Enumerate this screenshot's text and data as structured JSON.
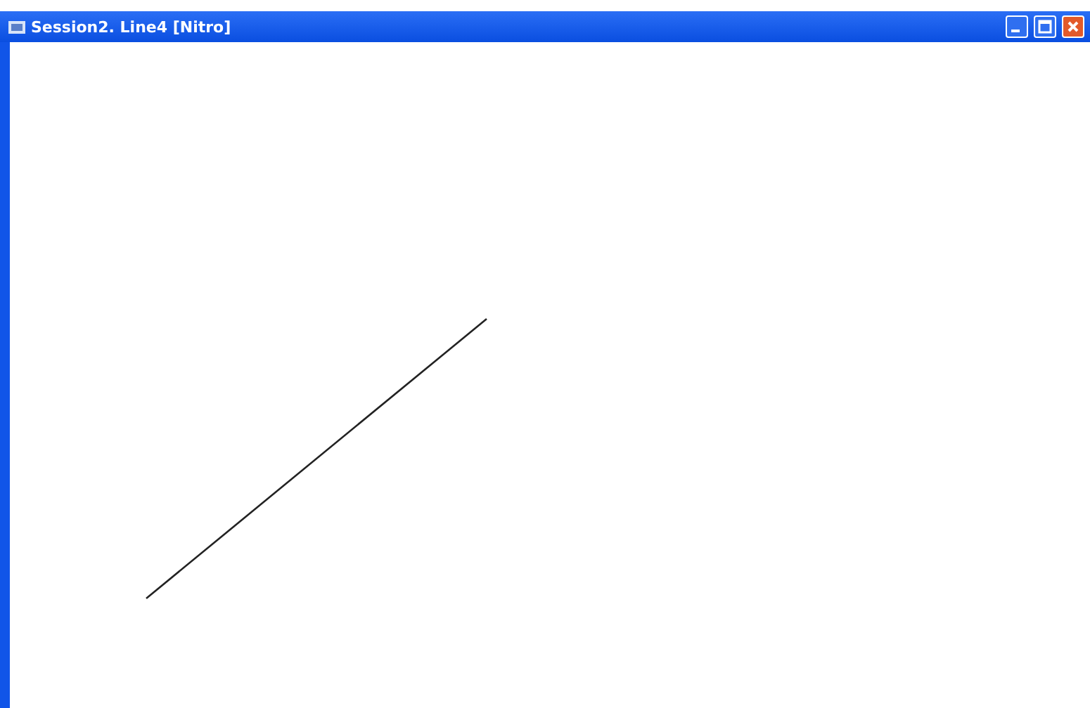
{
  "window": {
    "title": "Session2. Line4 [Nitro]"
  },
  "canvas": {
    "shapes": [
      {
        "kind": "line"
      }
    ]
  }
}
